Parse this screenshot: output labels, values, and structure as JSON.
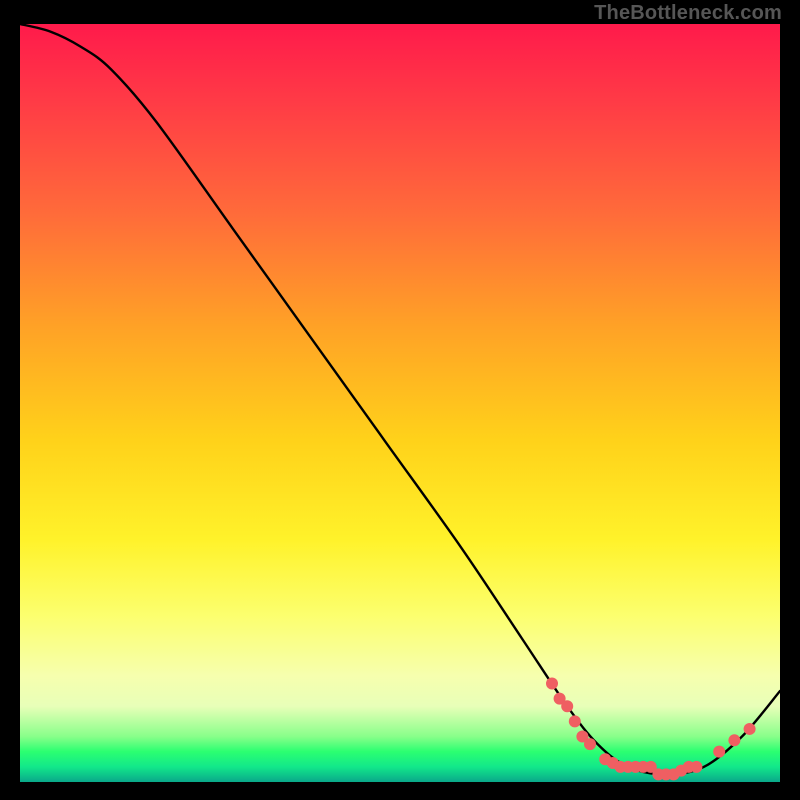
{
  "attribution": "TheBottleneck.com",
  "chart_data": {
    "type": "line",
    "title": "",
    "xlabel": "",
    "ylabel": "",
    "xlim": [
      0,
      100
    ],
    "ylim": [
      0,
      100
    ],
    "grid": false,
    "curve": {
      "name": "bottleneck-curve",
      "color": "#000000",
      "points": [
        {
          "x": 0,
          "y": 100
        },
        {
          "x": 4,
          "y": 99
        },
        {
          "x": 8,
          "y": 97
        },
        {
          "x": 12,
          "y": 94
        },
        {
          "x": 18,
          "y": 87
        },
        {
          "x": 28,
          "y": 73
        },
        {
          "x": 38,
          "y": 59
        },
        {
          "x": 48,
          "y": 45
        },
        {
          "x": 58,
          "y": 31
        },
        {
          "x": 66,
          "y": 19
        },
        {
          "x": 72,
          "y": 10
        },
        {
          "x": 76,
          "y": 5
        },
        {
          "x": 80,
          "y": 2
        },
        {
          "x": 85,
          "y": 1
        },
        {
          "x": 90,
          "y": 2
        },
        {
          "x": 95,
          "y": 6
        },
        {
          "x": 100,
          "y": 12
        }
      ]
    },
    "markers": {
      "name": "highlighted-points",
      "color": "#ef5f62",
      "radius": 6,
      "points": [
        {
          "x": 70,
          "y": 13
        },
        {
          "x": 71,
          "y": 11
        },
        {
          "x": 72,
          "y": 10
        },
        {
          "x": 73,
          "y": 8
        },
        {
          "x": 74,
          "y": 6
        },
        {
          "x": 75,
          "y": 5
        },
        {
          "x": 77,
          "y": 3
        },
        {
          "x": 78,
          "y": 2.5
        },
        {
          "x": 79,
          "y": 2
        },
        {
          "x": 80,
          "y": 2
        },
        {
          "x": 81,
          "y": 2
        },
        {
          "x": 82,
          "y": 2
        },
        {
          "x": 83,
          "y": 2
        },
        {
          "x": 84,
          "y": 1
        },
        {
          "x": 85,
          "y": 1
        },
        {
          "x": 86,
          "y": 1
        },
        {
          "x": 87,
          "y": 1.5
        },
        {
          "x": 88,
          "y": 2
        },
        {
          "x": 89,
          "y": 2
        },
        {
          "x": 92,
          "y": 4
        },
        {
          "x": 94,
          "y": 5.5
        },
        {
          "x": 96,
          "y": 7
        }
      ]
    }
  }
}
